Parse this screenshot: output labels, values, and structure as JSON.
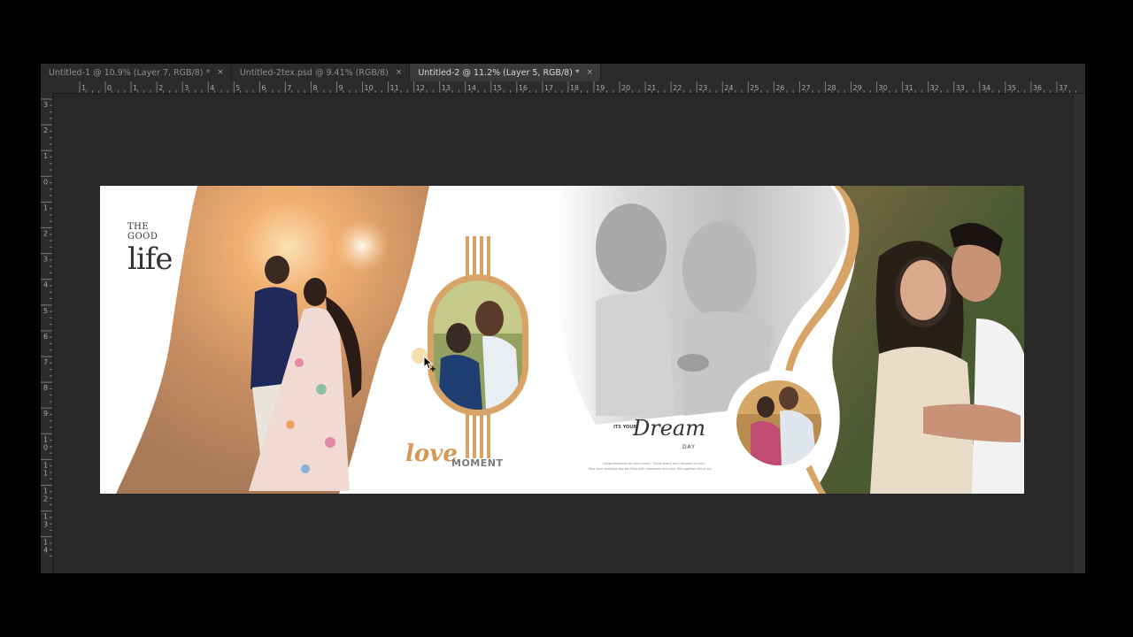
{
  "tabs": [
    {
      "label": "Untitled-1 @ 10.9% (Layer 7, RGB/8) *",
      "active": false
    },
    {
      "label": "Untitled-2tex.psd @ 9.41% (RGB/8)",
      "active": false
    },
    {
      "label": "Untitled-2 @ 11.2% (Layer 5, RGB/8) *",
      "active": true
    }
  ],
  "close_glyph": "×",
  "ruler": {
    "horizontal": [
      "1",
      "0",
      "1",
      "2",
      "3",
      "4",
      "5",
      "6",
      "7",
      "8",
      "9",
      "10",
      "11",
      "12",
      "13",
      "14",
      "15",
      "16",
      "17",
      "18",
      "19",
      "20",
      "21",
      "22",
      "23",
      "24",
      "25",
      "26",
      "27",
      "28",
      "29",
      "30",
      "31",
      "32",
      "33",
      "34",
      "35",
      "36",
      "37"
    ],
    "vertical": [
      "3",
      "2",
      "1",
      "0",
      "1",
      "2",
      "3",
      "4",
      "5",
      "6",
      "7",
      "8",
      "9",
      "10",
      "11",
      "12",
      "13",
      "14"
    ]
  },
  "album": {
    "the_good": "THE GOOD",
    "life": "life",
    "love": "love",
    "moment": "MOMENT",
    "its_your": "ITS YOUR",
    "dream": "Dream",
    "day": "DAY",
    "caption_line1": "Congratulations on your union / Today every we's focused on you!",
    "caption_line2": "May your wedding day be filled with memories and your life together full of joy"
  },
  "colors": {
    "accent": "#d8a366",
    "accent_dark": "#c98d4a"
  }
}
